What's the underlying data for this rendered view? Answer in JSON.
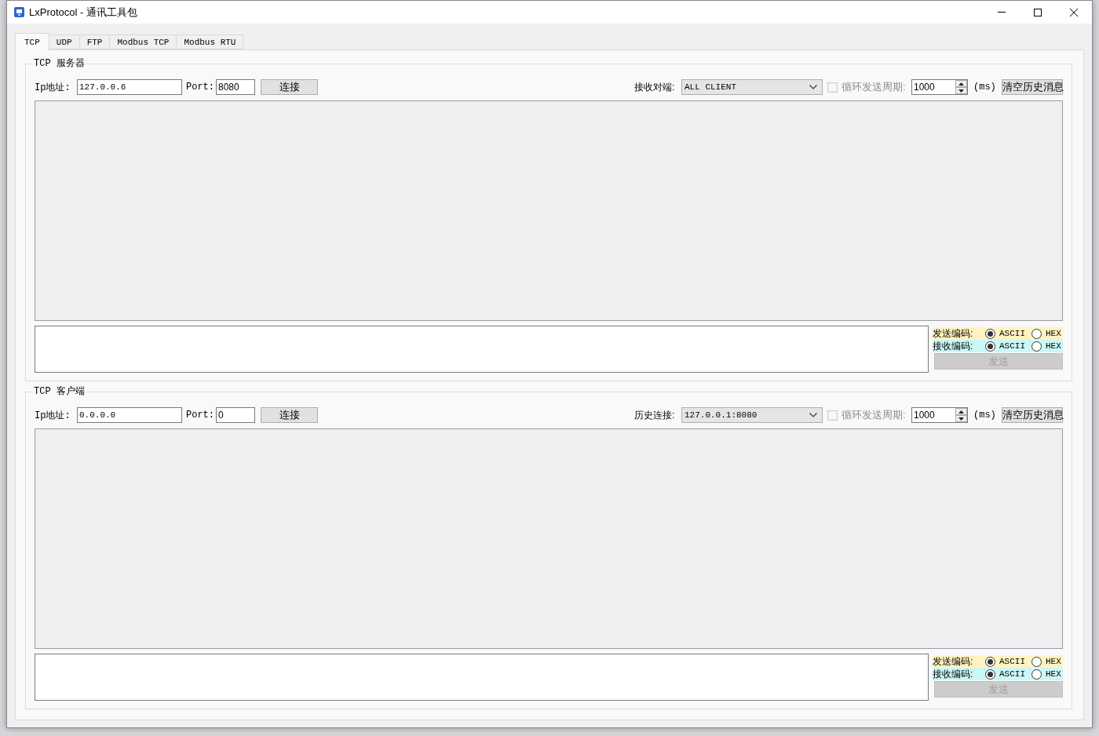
{
  "window": {
    "title": "LxProtocol - 通讯工具包"
  },
  "tabs": [
    {
      "label": "TCP",
      "selected": true
    },
    {
      "label": "UDP",
      "selected": false
    },
    {
      "label": "FTP",
      "selected": false
    },
    {
      "label": "Modbus TCP",
      "selected": false
    },
    {
      "label": "Modbus RTU",
      "selected": false
    }
  ],
  "groups": [
    {
      "title": "TCP 服务器",
      "ip": {
        "label": "Ip地址:",
        "value": "127.0.0.6"
      },
      "port": {
        "label": "Port:",
        "value": "8080"
      },
      "connect_button": "连接",
      "target": {
        "label": "接收对端:",
        "value": "ALL CLIENT"
      },
      "cycle": {
        "label": "循环发送周期:",
        "checked": false,
        "disabled": true
      },
      "period": {
        "value": "1000",
        "unit": "(ms)"
      },
      "clear_button": "清空历史消息",
      "encodings": [
        {
          "label": "发送编码:",
          "color": "#fff4c1",
          "options": [
            {
              "label": "ASCII",
              "selected": true
            },
            {
              "label": "HEX",
              "selected": false
            }
          ]
        },
        {
          "label": "接收编码:",
          "color": "#ccf7f7",
          "options": [
            {
              "label": "ASCII",
              "selected": true
            },
            {
              "label": "HEX",
              "selected": false
            }
          ]
        }
      ],
      "send_button": {
        "label": "发送",
        "disabled": true
      }
    },
    {
      "title": "TCP 客户端",
      "ip": {
        "label": "Ip地址:",
        "value": "0.0.0.0"
      },
      "port": {
        "label": "Port:",
        "value": "0"
      },
      "connect_button": "连接",
      "target": {
        "label": "历史连接:",
        "value": "127.0.0.1:8080"
      },
      "cycle": {
        "label": "循环发送周期:",
        "checked": false,
        "disabled": true
      },
      "period": {
        "value": "1000",
        "unit": "(ms)"
      },
      "clear_button": "清空历史消息",
      "encodings": [
        {
          "label": "发送编码:",
          "color": "#fff4c1",
          "options": [
            {
              "label": "ASCII",
              "selected": true
            },
            {
              "label": "HEX",
              "selected": false
            }
          ]
        },
        {
          "label": "接收编码:",
          "color": "#ccf7f7",
          "options": [
            {
              "label": "ASCII",
              "selected": true
            },
            {
              "label": "HEX",
              "selected": false
            }
          ]
        }
      ],
      "send_button": {
        "label": "发送",
        "disabled": true
      }
    }
  ]
}
